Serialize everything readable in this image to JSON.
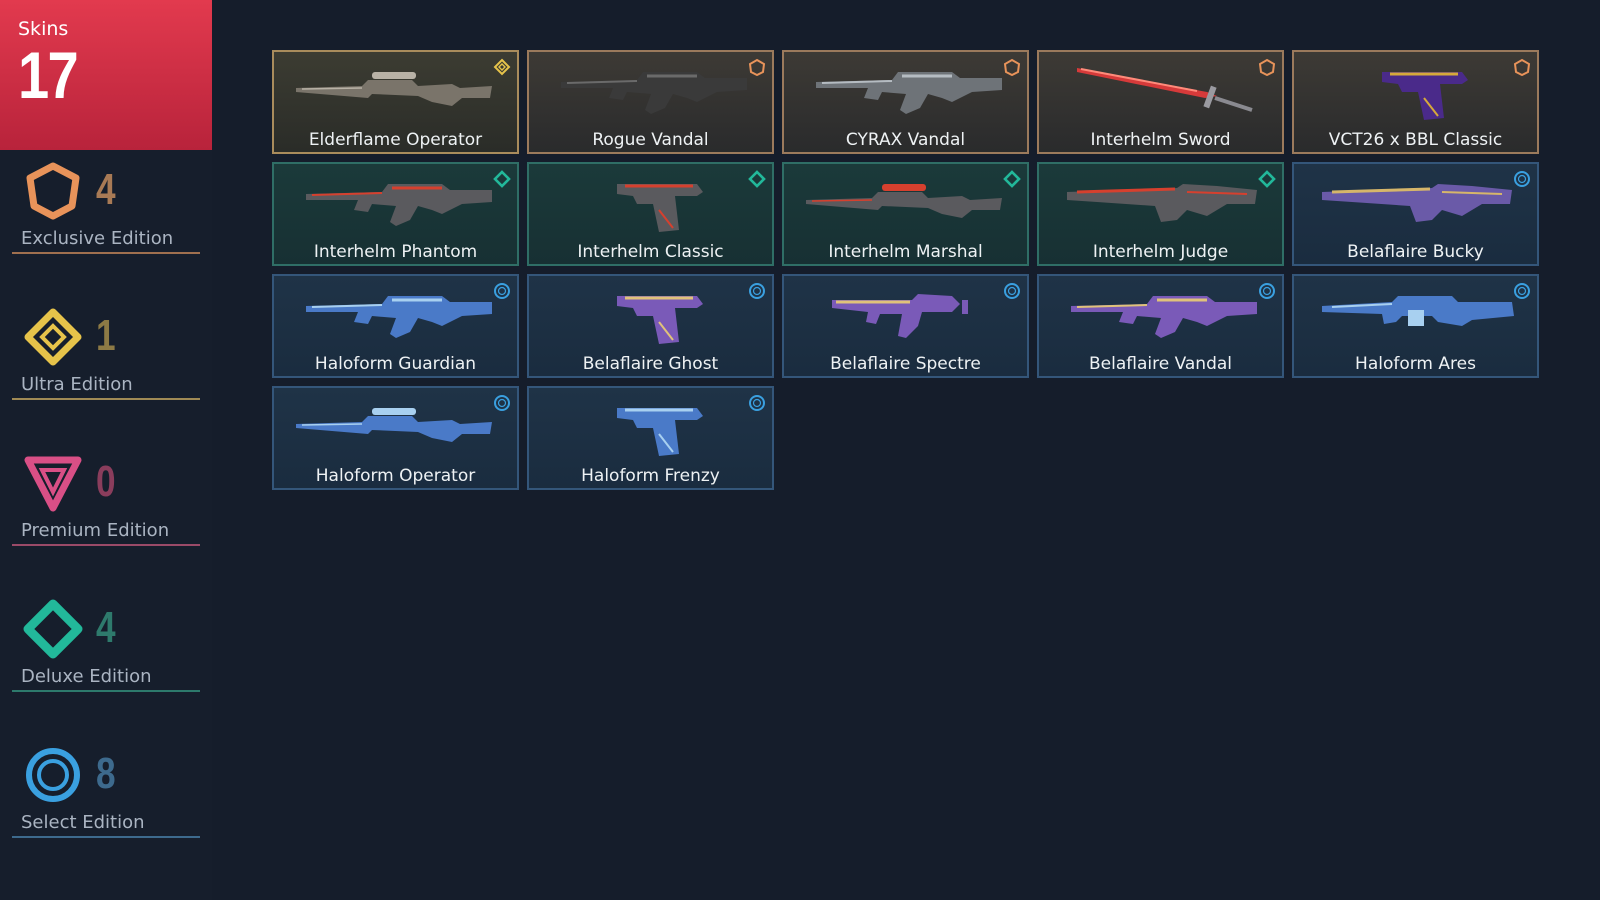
{
  "header": {
    "label": "Skins",
    "count": "17"
  },
  "tiers": [
    {
      "id": "exclusive",
      "name": "Exclusive Edition",
      "count": "4",
      "icon": "exclusive-edition-icon",
      "color": "#e8935a",
      "count_color": "#a87a55",
      "line_color": "#a0704f"
    },
    {
      "id": "ultra",
      "name": "Ultra Edition",
      "count": "1",
      "icon": "ultra-edition-icon",
      "color": "#e6c34a",
      "count_color": "#8d7a45",
      "line_color": "#a08a55"
    },
    {
      "id": "premium",
      "name": "Premium Edition",
      "count": "0",
      "icon": "premium-edition-icon",
      "color": "#d94f86",
      "count_color": "#8a3d5c",
      "line_color": "#9a4a68"
    },
    {
      "id": "deluxe",
      "name": "Deluxe Edition",
      "count": "4",
      "icon": "deluxe-edition-icon",
      "color": "#22b89a",
      "count_color": "#2e7a6c",
      "line_color": "#2d7a6c"
    },
    {
      "id": "select",
      "name": "Select Edition",
      "count": "8",
      "icon": "select-edition-icon",
      "color": "#3aa0e0",
      "count_color": "#3d6a8d",
      "line_color": "#3d6a8d"
    }
  ],
  "skins": [
    {
      "name": "Elderflame Operator",
      "tier": "ultra",
      "weapon": "sniper",
      "palette": [
        "#7a746a",
        "#b8b2a6"
      ]
    },
    {
      "name": "Rogue Vandal",
      "tier": "exclusive",
      "weapon": "rifle",
      "palette": [
        "#3a3a3a",
        "#6a6a6a"
      ]
    },
    {
      "name": "CYRAX Vandal",
      "tier": "exclusive",
      "weapon": "rifle",
      "palette": [
        "#6e7378",
        "#b5bcc2"
      ]
    },
    {
      "name": "Interhelm Sword",
      "tier": "exclusive",
      "weapon": "sword",
      "palette": [
        "#d63a3a",
        "#ff8a7a"
      ]
    },
    {
      "name": "VCT26 x BBL Classic",
      "tier": "exclusive",
      "weapon": "pistol",
      "palette": [
        "#4a2a8a",
        "#d6a93a"
      ]
    },
    {
      "name": "Interhelm Phantom",
      "tier": "deluxe",
      "weapon": "rifle",
      "palette": [
        "#5a5a5e",
        "#d6402e"
      ]
    },
    {
      "name": "Interhelm Classic",
      "tier": "deluxe",
      "weapon": "pistol",
      "palette": [
        "#5a5a5e",
        "#d6402e"
      ]
    },
    {
      "name": "Interhelm Marshal",
      "tier": "deluxe",
      "weapon": "sniper",
      "palette": [
        "#5a5a5e",
        "#d6402e"
      ]
    },
    {
      "name": "Interhelm Judge",
      "tier": "deluxe",
      "weapon": "shotgun",
      "palette": [
        "#5a5a5e",
        "#d6402e"
      ]
    },
    {
      "name": "Belaflaire Bucky",
      "tier": "select",
      "weapon": "shotgun",
      "palette": [
        "#6a5aa8",
        "#d6b66a"
      ]
    },
    {
      "name": "Haloform Guardian",
      "tier": "select",
      "weapon": "rifle",
      "palette": [
        "#4a7ac8",
        "#a8d0f0"
      ]
    },
    {
      "name": "Belaflaire Ghost",
      "tier": "select",
      "weapon": "pistol",
      "palette": [
        "#7a5ab8",
        "#e0c27a"
      ]
    },
    {
      "name": "Belaflaire Spectre",
      "tier": "select",
      "weapon": "smg",
      "palette": [
        "#7a5ab8",
        "#e0c27a"
      ]
    },
    {
      "name": "Belaflaire Vandal",
      "tier": "select",
      "weapon": "rifle",
      "palette": [
        "#7a5ab8",
        "#e0c27a"
      ]
    },
    {
      "name": "Haloform Ares",
      "tier": "select",
      "weapon": "lmg",
      "palette": [
        "#4a7ac8",
        "#a8d0f0"
      ]
    },
    {
      "name": "Haloform Operator",
      "tier": "select",
      "weapon": "sniper",
      "palette": [
        "#4a7ac8",
        "#a8d0f0"
      ]
    },
    {
      "name": "Haloform Frenzy",
      "tier": "select",
      "weapon": "pistol",
      "palette": [
        "#4a7ac8",
        "#a8d0f0"
      ]
    }
  ]
}
